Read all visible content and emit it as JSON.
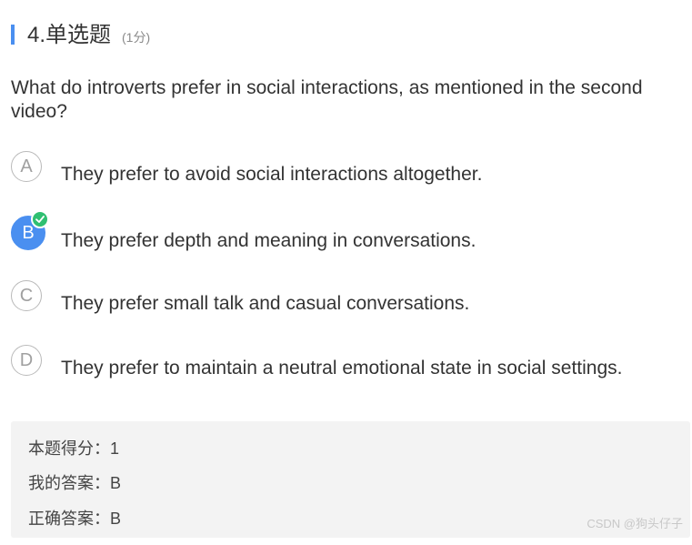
{
  "header": {
    "title": "4.单选题",
    "score": "(1分)"
  },
  "question": {
    "text": "What do introverts prefer in social interactions, as mentioned in the second video?"
  },
  "options": [
    {
      "letter": "A",
      "text": "They prefer to avoid social interactions altogether.",
      "selected": false
    },
    {
      "letter": "B",
      "text": "They prefer depth and meaning in conversations.",
      "selected": true
    },
    {
      "letter": "C",
      "text": "They prefer small talk and casual conversations.",
      "selected": false
    },
    {
      "letter": "D",
      "text": "They prefer to maintain a neutral emotional state in social settings.",
      "selected": false
    }
  ],
  "result": {
    "score_line": "本题得分：1",
    "my_answer_line": "我的答案：B",
    "correct_answer_line": "正确答案：B"
  },
  "watermark": "CSDN @狗头仔子",
  "colors": {
    "accent": "#4a8ff0",
    "check": "#2fbf71",
    "panel": "#f3f3f3"
  }
}
